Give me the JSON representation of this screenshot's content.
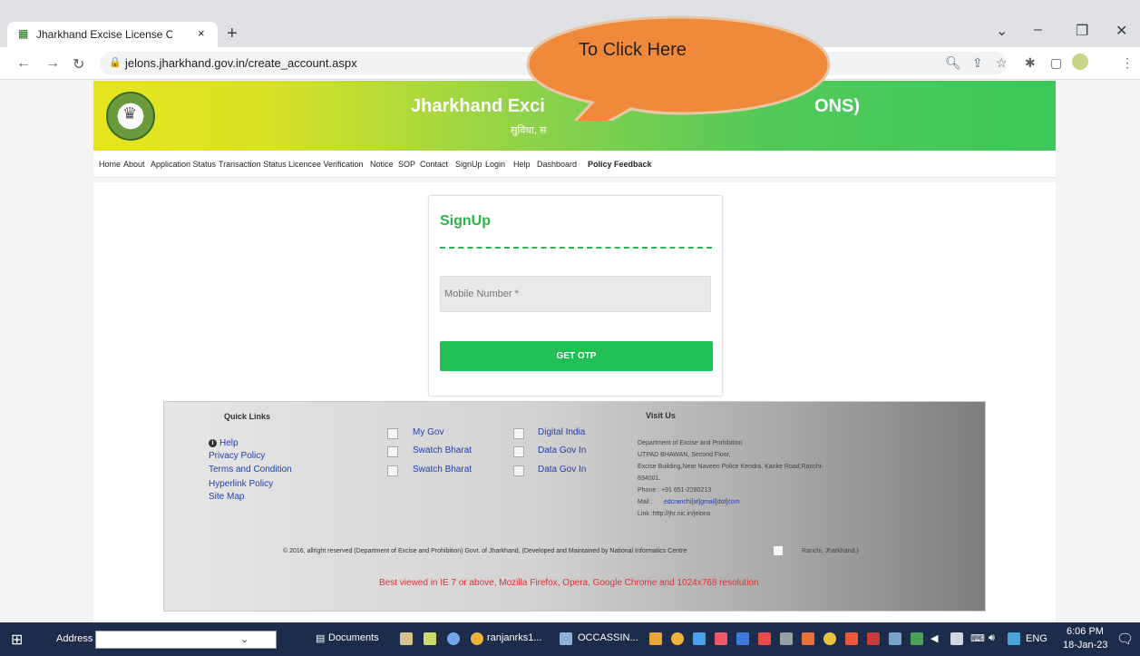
{
  "browser": {
    "tab_title": "Jharkhand Excise License Online",
    "tab_close": "×",
    "new_tab": "+",
    "url": "jelons.jharkhand.gov.in/create_account.aspx",
    "window": {
      "minimize": "–",
      "restore": "❐",
      "close": "✕",
      "tab_list": "⌄"
    }
  },
  "banner": {
    "title_left": "Jharkhand Exci",
    "title_right": "ONS)",
    "subtitle": "सुविधा, स"
  },
  "nav": {
    "items": [
      "Home",
      "About",
      "Application Status",
      "Transaction Status",
      "Licencee Verification",
      "Notice",
      "SOP",
      "Contact",
      "SignUp",
      "Login",
      "Help",
      "Dashboard",
      "Policy Feedback"
    ]
  },
  "signup": {
    "title": "SignUp",
    "mobile_placeholder": "Mobile Number *",
    "otp_button": "GET OTP"
  },
  "callout": {
    "text": "To Click Here"
  },
  "footer": {
    "quick_links_heading": "Quick Links",
    "quick_links": [
      "Help",
      "Privacy Policy",
      "Terms and Condition",
      "Hyperlink Policy",
      "Site Map"
    ],
    "partner_col1": [
      "My Gov",
      "Swatch Bharat",
      "Swatch Bharat"
    ],
    "partner_col2": [
      "Digital India",
      "Data Gov In",
      "Data Gov In"
    ],
    "visit_heading": "Visit Us",
    "visit_lines": [
      "Department of Excise and Prohibition",
      "UTPAD BHAWAN, Second Floor,",
      "Excise Building,Near Naveen Police Kendra, Kanke Road,Ranchi-",
      "834001.",
      "Phone :    +91 651-2280213"
    ],
    "mail_label": "Mail :",
    "mail_value": "edcranchi[at]gmail[dot]com",
    "link_line": "Link :http://jhr.nic.in/jelons",
    "copyright": "© 2016, allright reserved (Department of Excise and Prohibition) Govt. of Jharkhand, (Developed and Maintained by National Informatics Centre",
    "copyright_tail": "Ranchi, Jharkhand.)",
    "best_viewed": "Best viewed in IE 7 or above, Mozilla Firefox, Opera, Google Chrome and 1024x768 resolution"
  },
  "taskbar": {
    "address_label": "Address",
    "items": [
      "Documents",
      "ranjanrks1...",
      "OCCASSIN..."
    ],
    "lang": "ENG",
    "time": "6:06 PM",
    "date": "18-Jan-23"
  }
}
